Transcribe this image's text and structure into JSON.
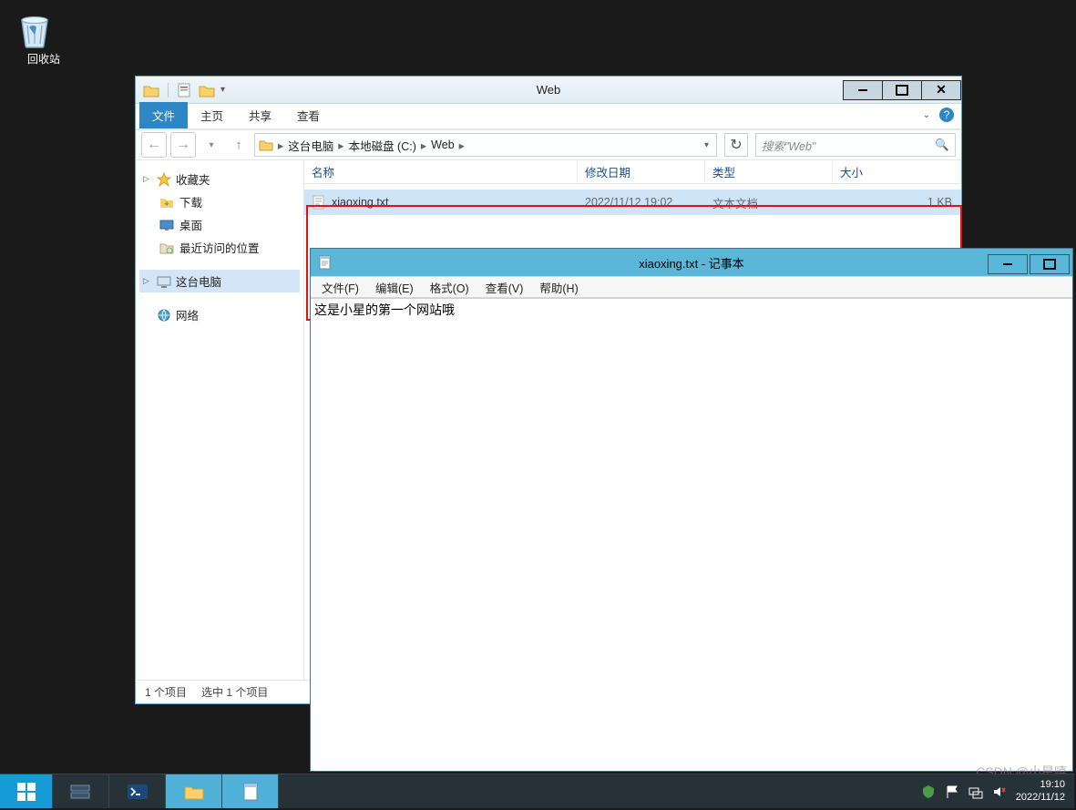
{
  "desktop": {
    "recycle_bin": "回收站"
  },
  "explorer": {
    "title": "Web",
    "tabs": {
      "file": "文件",
      "home": "主页",
      "share": "共享",
      "view": "查看"
    },
    "breadcrumb": {
      "pc": "这台电脑",
      "drive": "本地磁盘 (C:)",
      "folder": "Web"
    },
    "search_placeholder": "搜索\"Web\"",
    "columns": {
      "name": "名称",
      "date": "修改日期",
      "type": "类型",
      "size": "大小"
    },
    "sidebar": {
      "favorites": "收藏夹",
      "downloads": "下载",
      "desktop": "桌面",
      "recent": "最近访问的位置",
      "this_pc": "这台电脑",
      "network": "网络"
    },
    "file": {
      "name": "xiaoxing.txt",
      "date": "2022/11/12 19:02",
      "type": "文本文档",
      "size": "1 KB"
    },
    "status": {
      "count": "1 个项目",
      "selection": "选中 1 个项目"
    }
  },
  "notepad": {
    "title": "xiaoxing.txt - 记事本",
    "menu": {
      "file": "文件(F)",
      "edit": "编辑(E)",
      "format": "格式(O)",
      "view": "查看(V)",
      "help": "帮助(H)"
    },
    "content": "这是小星的第一个网站哦"
  },
  "taskbar": {
    "time": "19:10",
    "date": "2022/11/12"
  },
  "watermark": "CSDN @小星嘻"
}
